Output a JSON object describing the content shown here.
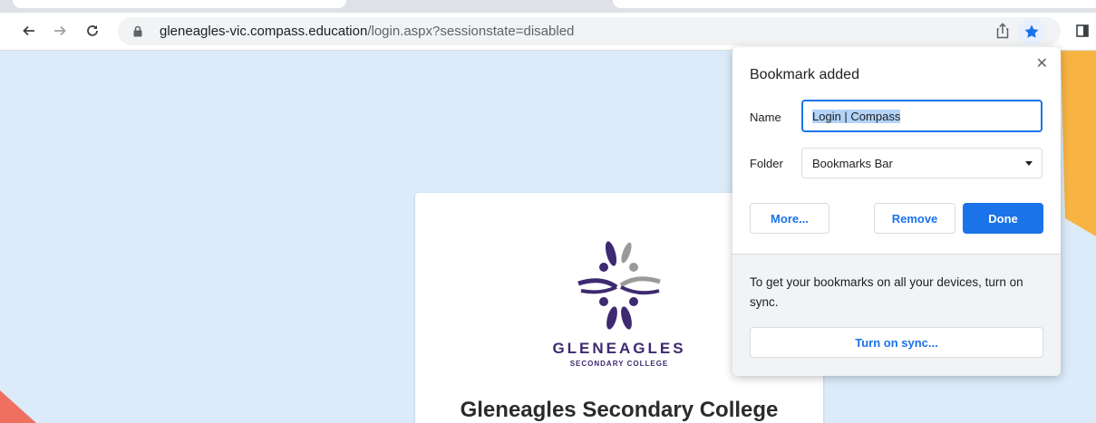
{
  "browser": {
    "url_host": "gleneagles-vic.compass.education",
    "url_path": "/login.aspx?sessionstate=disabled"
  },
  "icons": {
    "back": "back-arrow-icon",
    "forward": "forward-arrow-icon",
    "reload": "reload-icon",
    "lock": "lock-icon",
    "share": "share-icon",
    "bookmark": "star-icon",
    "side_panel": "side-panel-icon"
  },
  "page": {
    "logo_title": "GLENEAGLES",
    "logo_subtitle": "SECONDARY COLLEGE",
    "college_name": "Gleneagles Secondary College"
  },
  "bookmark_popup": {
    "title": "Bookmark added",
    "name_label": "Name",
    "name_value": "Login | Compass",
    "folder_label": "Folder",
    "folder_value": "Bookmarks Bar",
    "more_label": "More...",
    "remove_label": "Remove",
    "done_label": "Done",
    "sync_text": "To get your bookmarks on all your devices, turn on sync.",
    "sync_button_label": "Turn on sync..."
  },
  "colors": {
    "accent": "#1a73e8",
    "page_bg": "#dcebf9",
    "logo_purple": "#3d2a70",
    "logo_grey": "#9a9a9a",
    "decor_orange": "#f8b443",
    "decor_coral": "#f07060"
  }
}
